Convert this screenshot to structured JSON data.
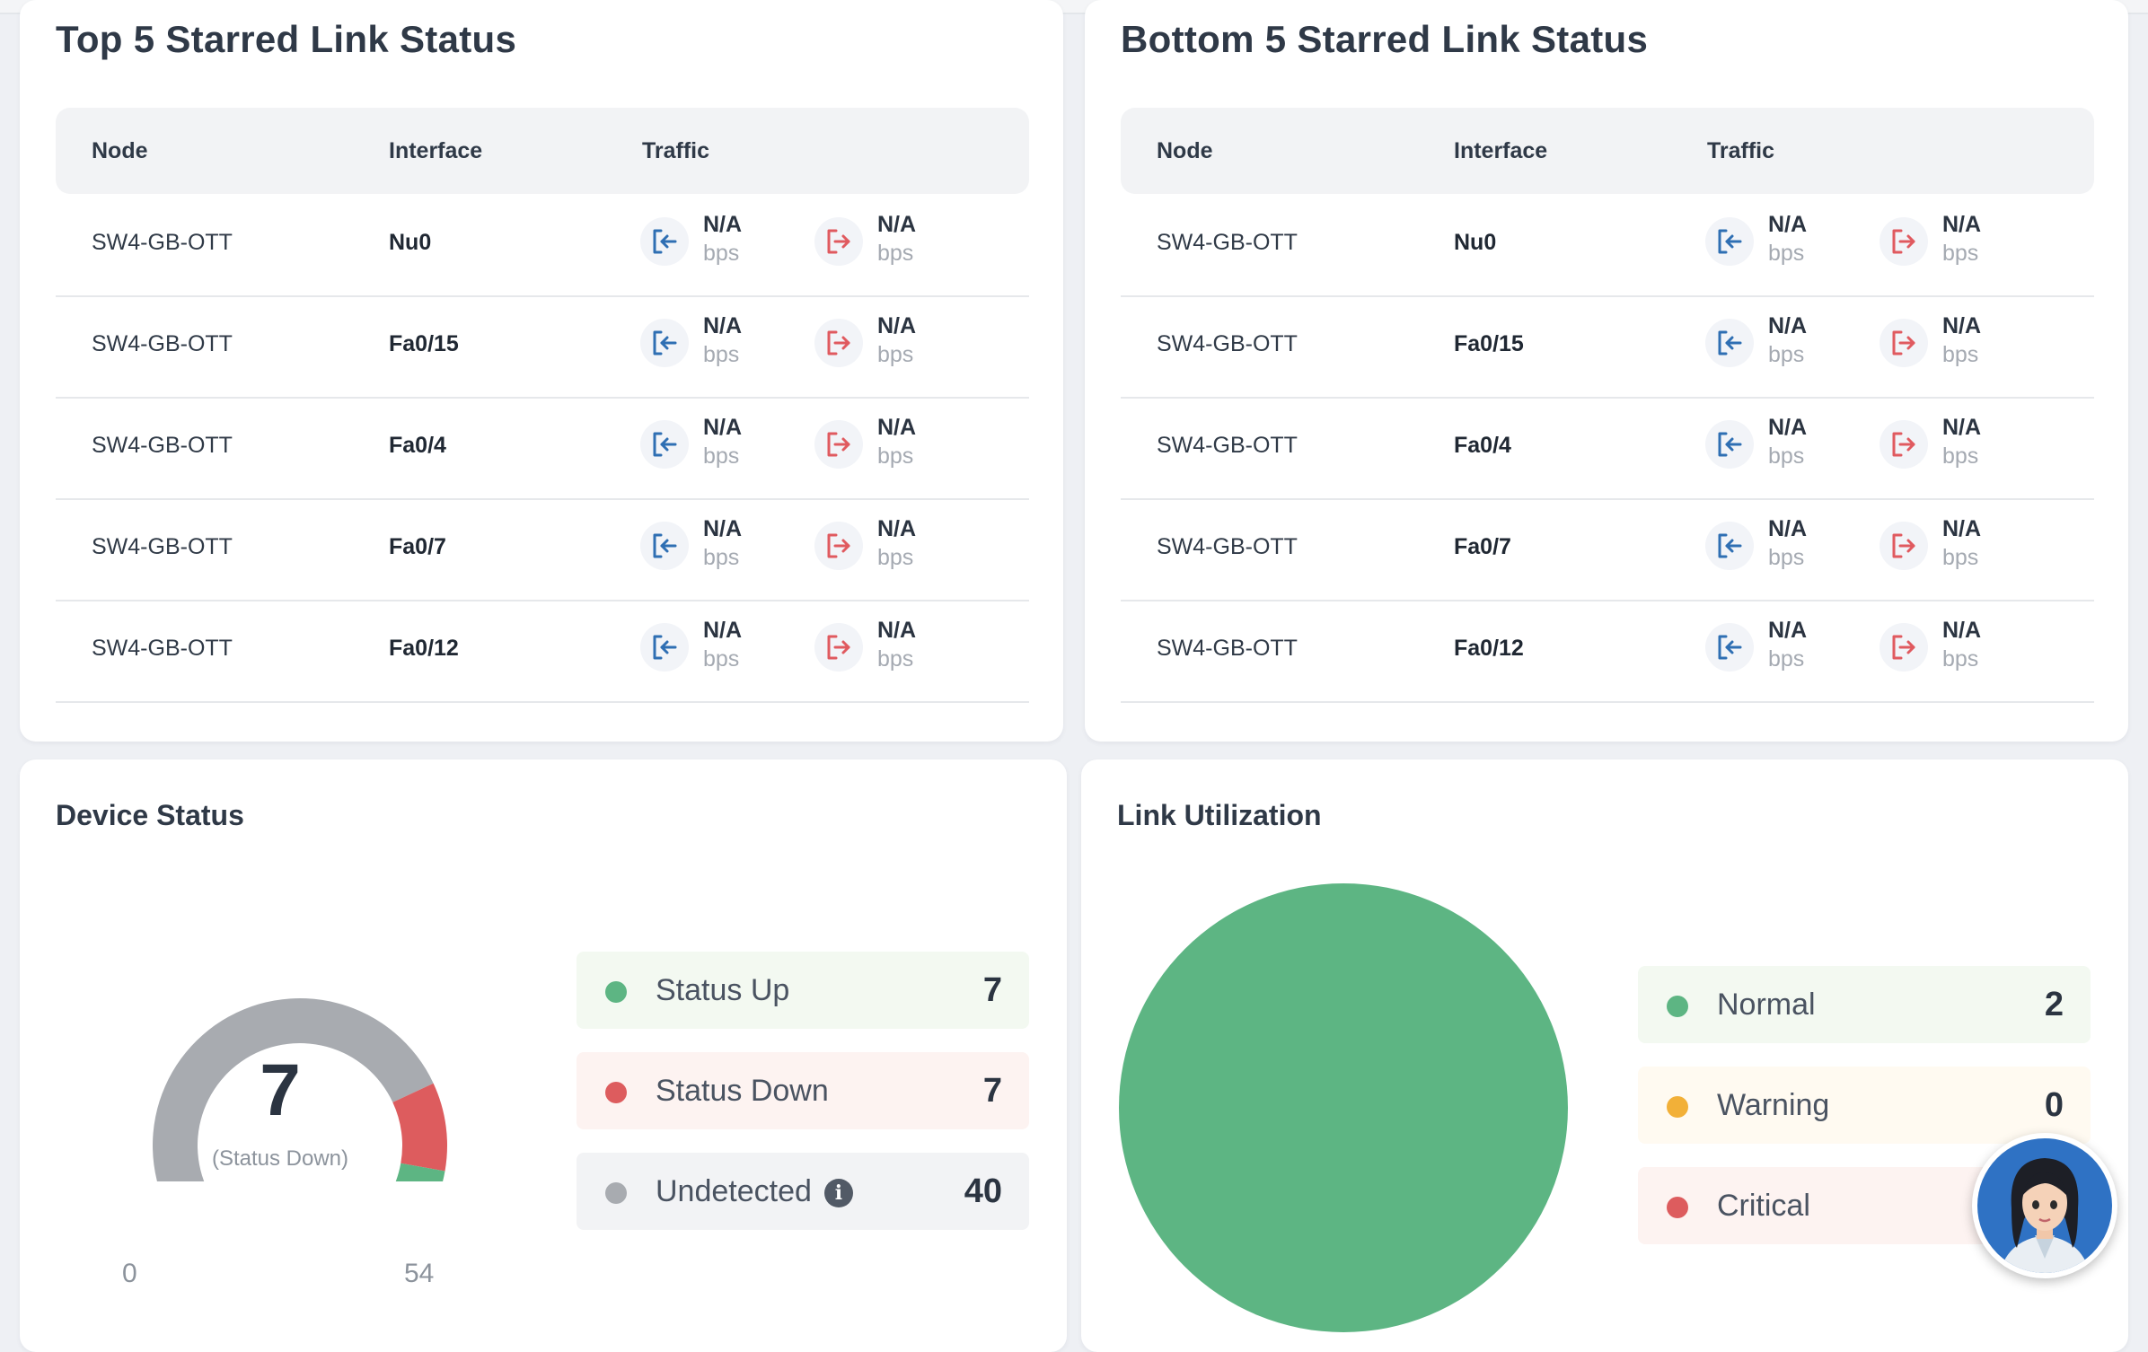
{
  "top_card": {
    "title": "Top 5 Starred Link Status",
    "headers": {
      "node": "Node",
      "interface": "Interface",
      "traffic": "Traffic"
    },
    "rows": [
      {
        "node": "SW4-GB-OTT",
        "interface": "Nu0",
        "in_value": "N/A",
        "in_unit": "bps",
        "out_value": "N/A",
        "out_unit": "bps"
      },
      {
        "node": "SW4-GB-OTT",
        "interface": "Fa0/15",
        "in_value": "N/A",
        "in_unit": "bps",
        "out_value": "N/A",
        "out_unit": "bps"
      },
      {
        "node": "SW4-GB-OTT",
        "interface": "Fa0/4",
        "in_value": "N/A",
        "in_unit": "bps",
        "out_value": "N/A",
        "out_unit": "bps"
      },
      {
        "node": "SW4-GB-OTT",
        "interface": "Fa0/7",
        "in_value": "N/A",
        "in_unit": "bps",
        "out_value": "N/A",
        "out_unit": "bps"
      },
      {
        "node": "SW4-GB-OTT",
        "interface": "Fa0/12",
        "in_value": "N/A",
        "in_unit": "bps",
        "out_value": "N/A",
        "out_unit": "bps"
      }
    ]
  },
  "bottom_card": {
    "title": "Bottom 5 Starred Link Status",
    "headers": {
      "node": "Node",
      "interface": "Interface",
      "traffic": "Traffic"
    },
    "rows": [
      {
        "node": "SW4-GB-OTT",
        "interface": "Nu0",
        "in_value": "N/A",
        "in_unit": "bps",
        "out_value": "N/A",
        "out_unit": "bps"
      },
      {
        "node": "SW4-GB-OTT",
        "interface": "Fa0/15",
        "in_value": "N/A",
        "in_unit": "bps",
        "out_value": "N/A",
        "out_unit": "bps"
      },
      {
        "node": "SW4-GB-OTT",
        "interface": "Fa0/4",
        "in_value": "N/A",
        "in_unit": "bps",
        "out_value": "N/A",
        "out_unit": "bps"
      },
      {
        "node": "SW4-GB-OTT",
        "interface": "Fa0/7",
        "in_value": "N/A",
        "in_unit": "bps",
        "out_value": "N/A",
        "out_unit": "bps"
      },
      {
        "node": "SW4-GB-OTT",
        "interface": "Fa0/12",
        "in_value": "N/A",
        "in_unit": "bps",
        "out_value": "N/A",
        "out_unit": "bps"
      }
    ]
  },
  "icons": {
    "traffic_in": "sign-in-icon",
    "traffic_out": "sign-out-icon",
    "info": "info-icon",
    "assistant": "assistant-avatar"
  },
  "colors": {
    "in": "#2f6fb3",
    "out": "#e05a5f",
    "up": "#5db583",
    "down": "#dd5c5e",
    "undetected": "#a8abb0",
    "warning": "#f2b038",
    "normal": "#5db583"
  },
  "device_status": {
    "title": "Device Status",
    "gauge_value": "7",
    "gauge_caption": "(Status Down)",
    "gauge_min": "0",
    "gauge_max": "54",
    "legend": [
      {
        "label": "Status Up",
        "count": "7"
      },
      {
        "label": "Status Down",
        "count": "7"
      },
      {
        "label": "Undetected",
        "count": "40"
      }
    ]
  },
  "link_utilization": {
    "title": "Link Utilization",
    "legend": [
      {
        "label": "Normal",
        "count": "2"
      },
      {
        "label": "Warning",
        "count": "0"
      },
      {
        "label": "Critical",
        "count": ""
      }
    ]
  },
  "chart_data": [
    {
      "type": "pie",
      "title": "Device Status",
      "categories": [
        "Status Up",
        "Status Down",
        "Undetected"
      ],
      "values": [
        7,
        7,
        40
      ],
      "range": [
        0,
        54
      ]
    },
    {
      "type": "pie",
      "title": "Link Utilization",
      "categories": [
        "Normal",
        "Warning",
        "Critical"
      ],
      "values": [
        2,
        0,
        0
      ]
    }
  ]
}
